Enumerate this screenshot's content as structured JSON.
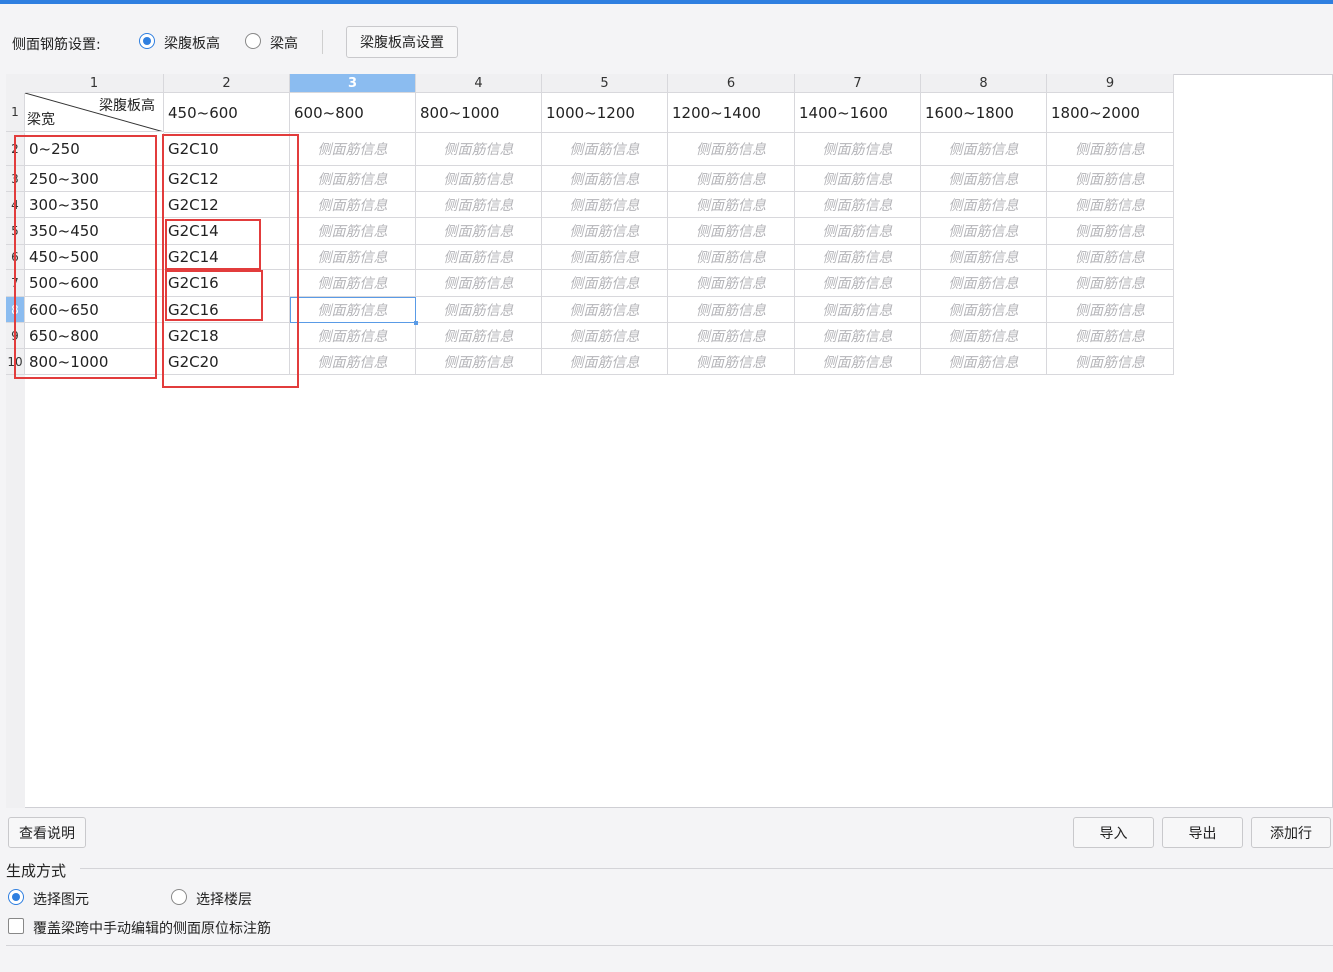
{
  "toolbar": {
    "label": "侧面钢筋设置:",
    "radio_option_1": "梁腹板高",
    "radio_option_2": "梁高",
    "selected": "梁腹板高",
    "settings_button": "梁腹板高设置"
  },
  "table": {
    "column_numbers": [
      "1",
      "2",
      "3",
      "4",
      "5",
      "6",
      "7",
      "8",
      "9"
    ],
    "selected_column": "3",
    "corner_top": "梁腹板高",
    "corner_bottom": "梁宽",
    "header_row_number": "1",
    "height_ranges": [
      "450~600",
      "600~800",
      "800~1000",
      "1000~1200",
      "1200~1400",
      "1400~1600",
      "1600~1800",
      "1800~2000"
    ],
    "placeholder": "侧面筋信息",
    "rows": [
      {
        "num": "2",
        "width": "0~250",
        "value": "G2C10"
      },
      {
        "num": "3",
        "width": "250~300",
        "value": "G2C12"
      },
      {
        "num": "4",
        "width": "300~350",
        "value": "G2C12"
      },
      {
        "num": "5",
        "width": "350~450",
        "value": "G2C14"
      },
      {
        "num": "6",
        "width": "450~500",
        "value": "G2C14"
      },
      {
        "num": "7",
        "width": "500~600",
        "value": "G2C16"
      },
      {
        "num": "8",
        "width": "600~650",
        "value": "G2C16"
      },
      {
        "num": "9",
        "width": "650~800",
        "value": "G2C18"
      },
      {
        "num": "10",
        "width": "800~1000",
        "value": "G2C20"
      }
    ],
    "selected_row": "8"
  },
  "buttons": {
    "help": "查看说明",
    "import": "导入",
    "export": "导出",
    "add_row": "添加行"
  },
  "generation": {
    "title": "生成方式",
    "option_1": "选择图元",
    "option_2": "选择楼层",
    "selected": "选择图元",
    "override_checkbox": "覆盖梁跨中手动编辑的侧面原位标注筋",
    "override_checked": false
  },
  "colors": {
    "accent": "#2f7fe0",
    "highlight": "#e23c3c",
    "selected_header": "#8bbcf0"
  }
}
